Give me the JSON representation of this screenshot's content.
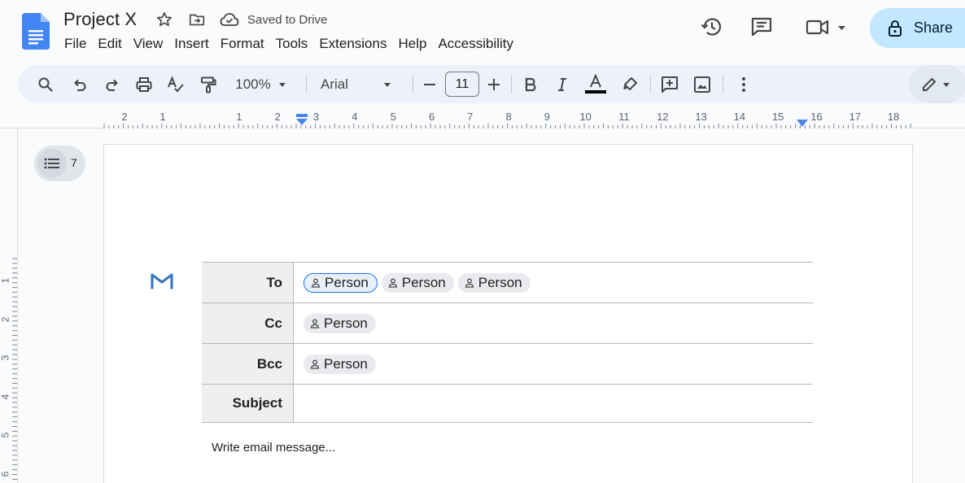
{
  "doc": {
    "title": "Project X",
    "save_status": "Saved to Drive"
  },
  "menu": [
    "File",
    "Edit",
    "View",
    "Insert",
    "Format",
    "Tools",
    "Extensions",
    "Help",
    "Accessibility"
  ],
  "share": {
    "label": "Share"
  },
  "toolbar": {
    "zoom": "100%",
    "font": "Arial",
    "font_size": "11"
  },
  "ruler": {
    "h_labels": [
      "2",
      "1",
      "1",
      "2",
      "3",
      "4",
      "5",
      "6",
      "7",
      "8",
      "9",
      "10",
      "11",
      "12",
      "13",
      "14",
      "15",
      "16",
      "17",
      "18"
    ],
    "v_labels": [
      "1",
      "2",
      "3",
      "4",
      "5",
      "6"
    ]
  },
  "outline": {
    "count": "7"
  },
  "email": {
    "rows": [
      {
        "label": "To",
        "chips": [
          "Person",
          "Person",
          "Person"
        ]
      },
      {
        "label": "Cc",
        "chips": [
          "Person"
        ]
      },
      {
        "label": "Bcc",
        "chips": [
          "Person"
        ]
      },
      {
        "label": "Subject",
        "chips": []
      }
    ],
    "message_placeholder": "Write email message..."
  },
  "colors": {
    "docs_blue": "#4285f4",
    "share_bg": "#c2e7ff",
    "toolbar_bg": "#edf2fa",
    "text_color_bar": "#000000",
    "gmail_blue": "#3b78c3"
  },
  "icons": {
    "header": [
      "docs-logo-icon",
      "star-icon",
      "move-folder-icon",
      "cloud-saved-icon",
      "version-history-icon",
      "comments-icon",
      "meet-icon",
      "lock-icon"
    ],
    "toolbar": [
      "search-icon",
      "undo-icon",
      "redo-icon",
      "print-icon",
      "spellcheck-icon",
      "paint-format-icon",
      "bold-icon",
      "italic-icon",
      "text-color-icon",
      "highlight-icon",
      "add-comment-icon",
      "insert-image-icon",
      "more-icon",
      "editing-mode-icon"
    ]
  }
}
